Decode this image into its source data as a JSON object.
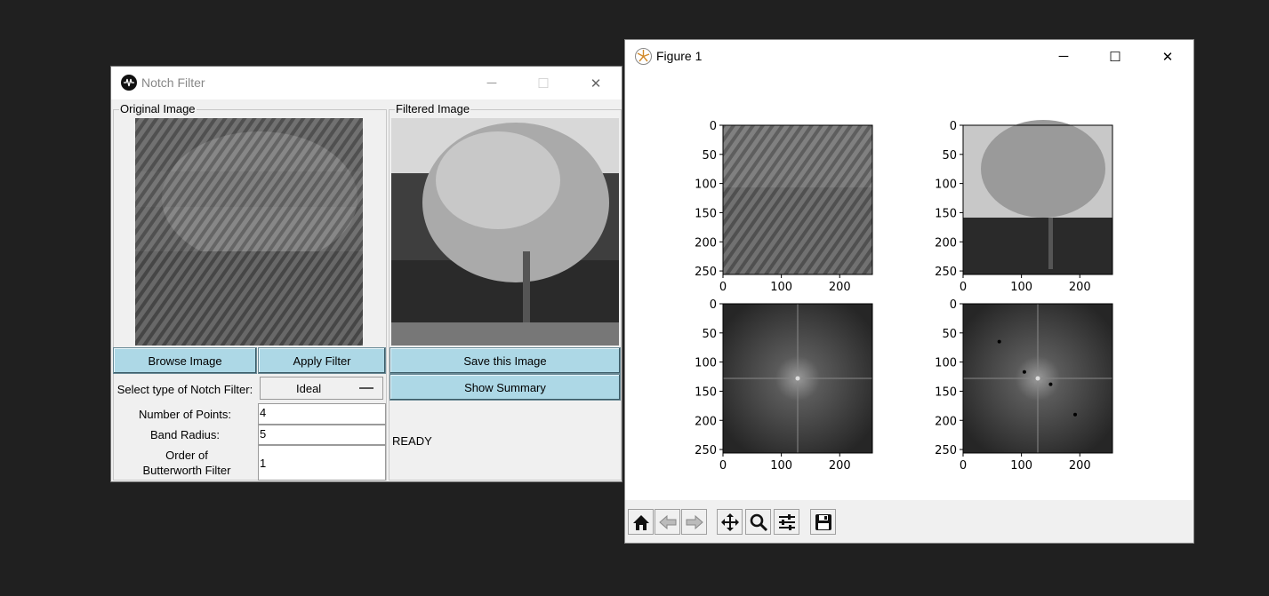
{
  "notch_window": {
    "title": "Notch Filter",
    "controls": {
      "minimize": "─",
      "maximize": "☐",
      "close": "✕"
    },
    "original_group_label": "Original Image",
    "filtered_group_label": "Filtered Image",
    "buttons": {
      "browse": "Browse Image",
      "apply": "Apply Filter",
      "save": "Save this Image",
      "summary": "Show Summary"
    },
    "filter_type_label": "Select type of Notch Filter:",
    "filter_type_value": "Ideal",
    "num_points_label": "Number of Points:",
    "num_points_value": "4",
    "band_radius_label": "Band Radius:",
    "band_radius_value": "5",
    "order_label_line1": "Order of",
    "order_label_line2": "Butterworth Filter",
    "order_value": "1",
    "status": "READY"
  },
  "figure_window": {
    "title": "Figure 1",
    "controls": {
      "minimize": "─",
      "maximize": "☐",
      "close": "✕"
    },
    "toolbar_icons": [
      "home-icon",
      "back-icon",
      "forward-icon",
      "pan-icon",
      "zoom-icon",
      "configure-subplots-icon",
      "save-icon"
    ]
  },
  "chart_data": [
    {
      "type": "heatmap",
      "panel": "original-image",
      "x_ticks": [
        0,
        100,
        200
      ],
      "y_ticks": [
        0,
        50,
        100,
        150,
        200,
        250
      ],
      "xlim": [
        0,
        256
      ],
      "ylim": [
        256,
        0
      ]
    },
    {
      "type": "heatmap",
      "panel": "filtered-image",
      "x_ticks": [
        0,
        100,
        200
      ],
      "y_ticks": [
        0,
        50,
        100,
        150,
        200,
        250
      ],
      "xlim": [
        0,
        256
      ],
      "ylim": [
        256,
        0
      ]
    },
    {
      "type": "heatmap",
      "panel": "original-spectrum",
      "x_ticks": [
        0,
        100,
        200
      ],
      "y_ticks": [
        0,
        50,
        100,
        150,
        200,
        250
      ],
      "xlim": [
        0,
        256
      ],
      "ylim": [
        256,
        0
      ]
    },
    {
      "type": "heatmap",
      "panel": "filtered-spectrum",
      "x_ticks": [
        0,
        100,
        200
      ],
      "y_ticks": [
        0,
        50,
        100,
        150,
        200,
        250
      ],
      "xlim": [
        0,
        256
      ],
      "ylim": [
        256,
        0
      ],
      "notch_points": [
        [
          62,
          65
        ],
        [
          105,
          117
        ],
        [
          150,
          138
        ],
        [
          192,
          190
        ]
      ]
    }
  ]
}
